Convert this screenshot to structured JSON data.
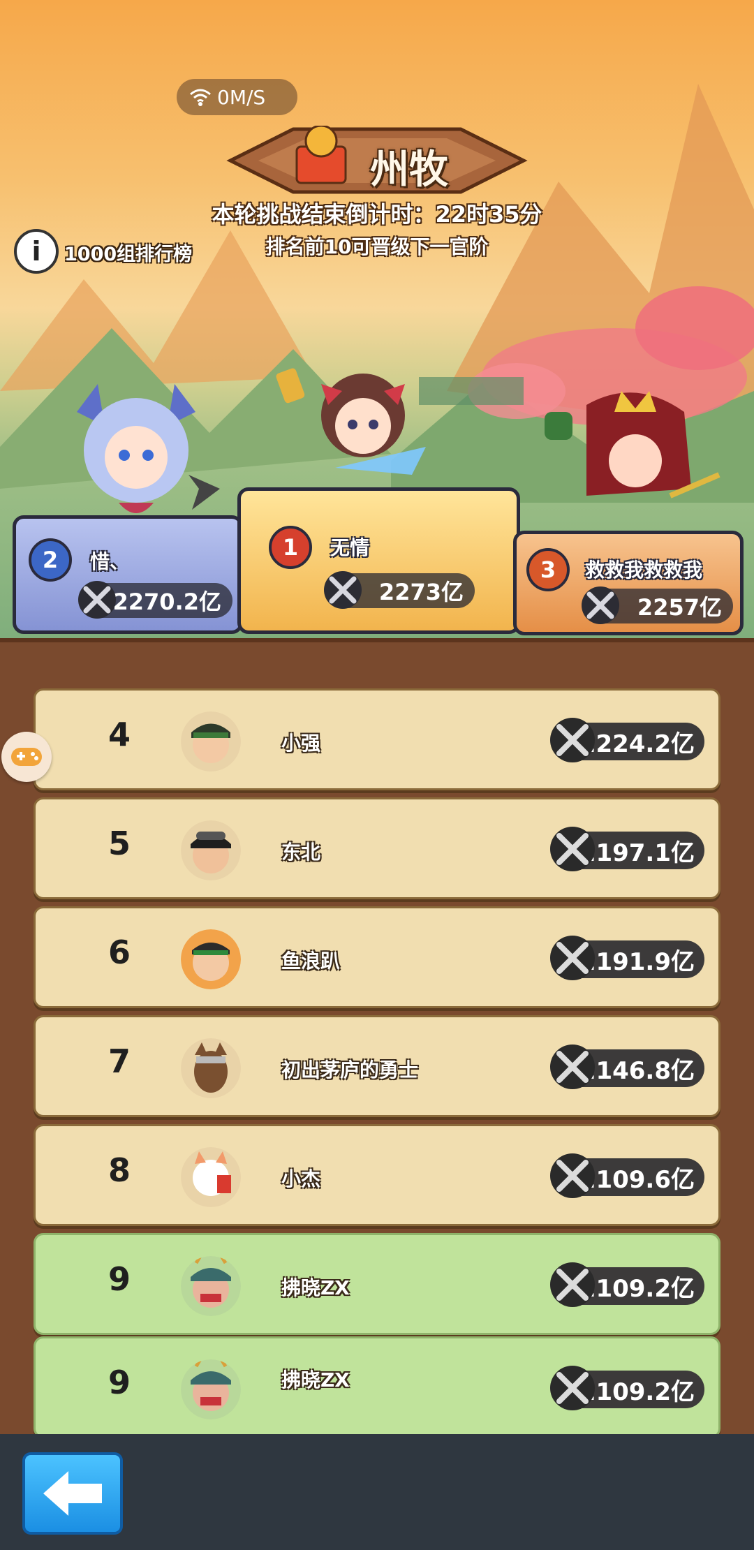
{
  "status": {
    "network_speed": "0M/S"
  },
  "header": {
    "rank_title": "州牧",
    "countdown": "本轮挑战结束倒计时：22时35分",
    "promotion_note": "排名前10可晋级下一官阶",
    "group_label": "1000组排行榜",
    "info_icon": "info-icon"
  },
  "podium": {
    "first": {
      "rank": "1",
      "name": "无情",
      "power": "2273亿"
    },
    "second": {
      "rank": "2",
      "name": "惜、",
      "power": "2270.2亿"
    },
    "third": {
      "rank": "3",
      "name": "救救我救救我",
      "power": "2257亿"
    }
  },
  "leaderboard": [
    {
      "rank": "4",
      "name": "小强",
      "power": "2224.2亿",
      "highlight": false
    },
    {
      "rank": "5",
      "name": "东北",
      "power": "2197.1亿",
      "highlight": false
    },
    {
      "rank": "6",
      "name": "鱼浪趴",
      "power": "2191.9亿",
      "highlight": false
    },
    {
      "rank": "7",
      "name": "初出茅庐的勇士",
      "power": "2146.8亿",
      "highlight": false
    },
    {
      "rank": "8",
      "name": "小杰",
      "power": "2109.6亿",
      "highlight": false
    },
    {
      "rank": "9",
      "name": "拂晓ZX",
      "power": "2109.2亿",
      "highlight": true
    },
    {
      "rank": "9",
      "name": "拂晓ZX",
      "power": "2109.2亿",
      "highlight": true
    }
  ],
  "colors": {
    "row_tan": "#f1deb0",
    "row_green": "#c0e39b",
    "board": "#7a4a2e",
    "back_button": "#1b8fe3"
  },
  "controls": {
    "back_icon": "back-arrow-icon",
    "side_icon": "gamepad-icon"
  }
}
